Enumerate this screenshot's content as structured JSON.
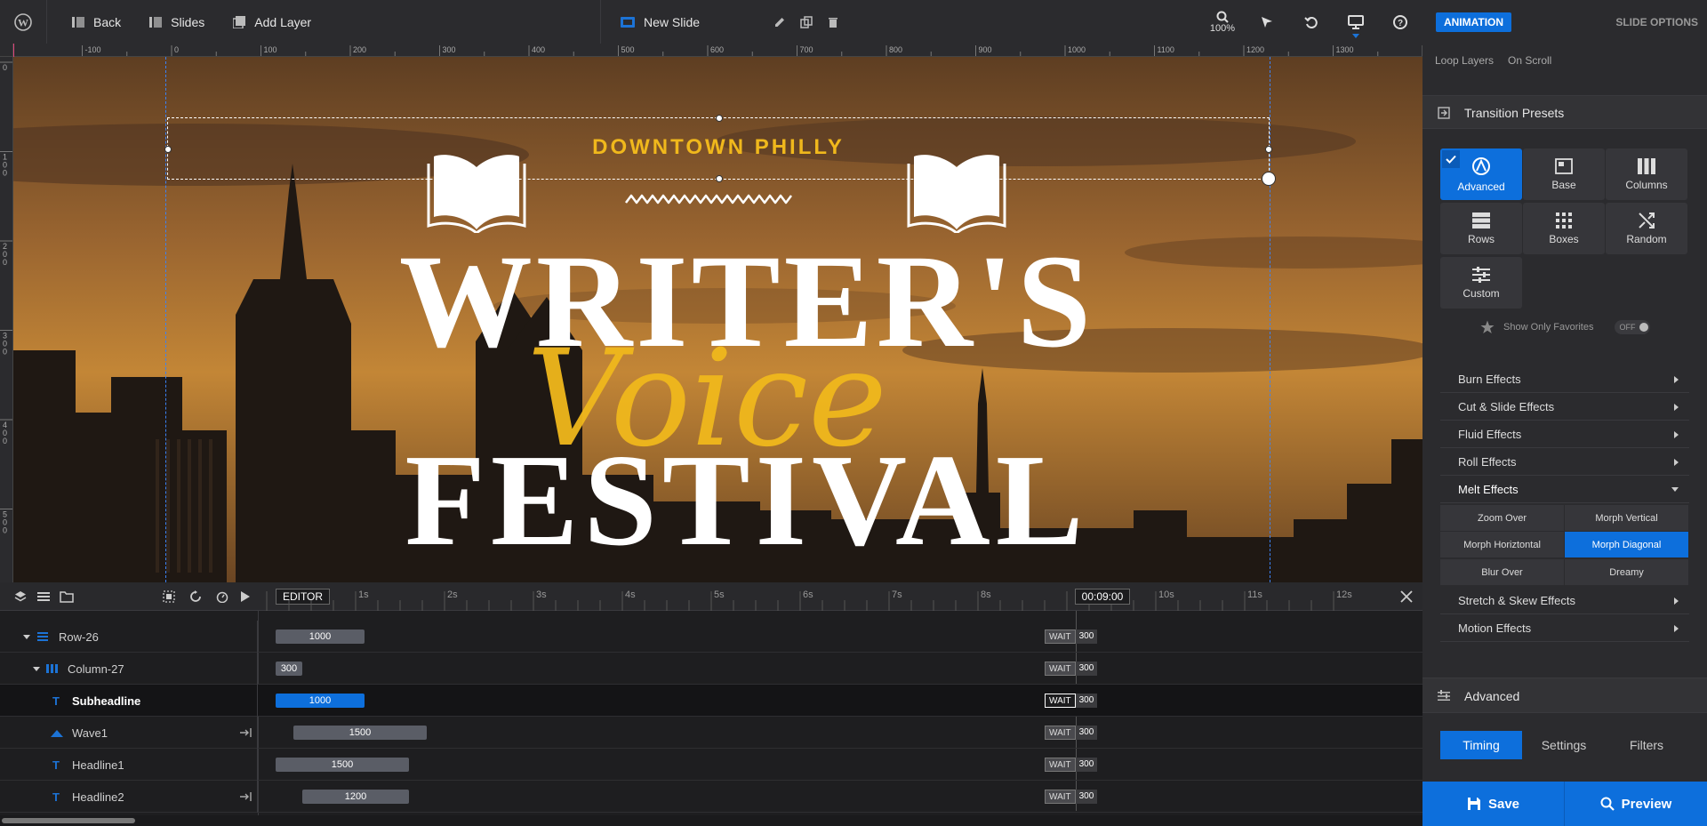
{
  "topbar": {
    "back": "Back",
    "slides": "Slides",
    "add_layer": "Add Layer",
    "slide_name": "New Slide",
    "zoom": "100%"
  },
  "ruler": {
    "h_labels": [
      "-100",
      "0",
      "100",
      "200",
      "300",
      "400",
      "500",
      "600",
      "700",
      "800",
      "900",
      "1000",
      "1100",
      "1200",
      "1300"
    ],
    "v_labels": [
      "0",
      "100",
      "200",
      "300",
      "400",
      "500"
    ]
  },
  "canvas": {
    "subheadline": "DOWNTOWN PHILLY",
    "headline1": "WRITER'S",
    "script": "Voice",
    "headline2": "FESTIVAL"
  },
  "timeline": {
    "editor_label": "EDITOR",
    "time_marks": [
      "1s",
      "2s",
      "3s",
      "4s",
      "5s",
      "6s",
      "7s",
      "8s",
      "9s",
      "10s",
      "11s",
      "12s"
    ],
    "current_time": "00:09:00",
    "wait_label": "WAIT",
    "rows": [
      {
        "name": "Row-26",
        "duration": "1000",
        "end": "300"
      },
      {
        "name": "Column-27",
        "duration": "300",
        "end": "300"
      },
      {
        "name": "Subheadline",
        "duration": "1000",
        "end": "300"
      },
      {
        "name": "Wave1",
        "duration": "1500",
        "end": "300"
      },
      {
        "name": "Headline1",
        "duration": "1500",
        "end": "300"
      },
      {
        "name": "Headline2",
        "duration": "1200",
        "end": "300"
      }
    ]
  },
  "sidebar": {
    "tab_animation": "ANIMATION",
    "tab_slide_options": "SLIDE OPTIONS",
    "loop_layers": "Loop Layers",
    "on_scroll": "On Scroll",
    "transition_presets": "Transition Presets",
    "presets": [
      {
        "label": "Advanced",
        "icon": "advanced-icon"
      },
      {
        "label": "Base",
        "icon": "base-icon"
      },
      {
        "label": "Columns",
        "icon": "columns-icon"
      },
      {
        "label": "Rows",
        "icon": "rows-icon"
      },
      {
        "label": "Boxes",
        "icon": "boxes-icon"
      },
      {
        "label": "Random",
        "icon": "random-icon"
      },
      {
        "label": "Custom",
        "icon": "custom-icon"
      }
    ],
    "show_only_favorites": "Show Only Favorites",
    "favorites_toggle": "OFF",
    "effects": [
      "Burn Effects",
      "Cut & Slide Effects",
      "Fluid Effects",
      "Roll Effects",
      "Melt Effects"
    ],
    "melt_options": [
      "Zoom Over",
      "Morph Vertical",
      "Morph Horiztontal",
      "Morph Diagonal",
      "Blur Over",
      "Dreamy"
    ],
    "effects_after": [
      "Stretch & Skew Effects",
      "Motion Effects"
    ],
    "advanced": "Advanced",
    "sub_tabs": [
      "Timing",
      "Settings",
      "Filters"
    ],
    "save": "Save",
    "preview": "Preview",
    "accent": "#0d6fdc"
  }
}
